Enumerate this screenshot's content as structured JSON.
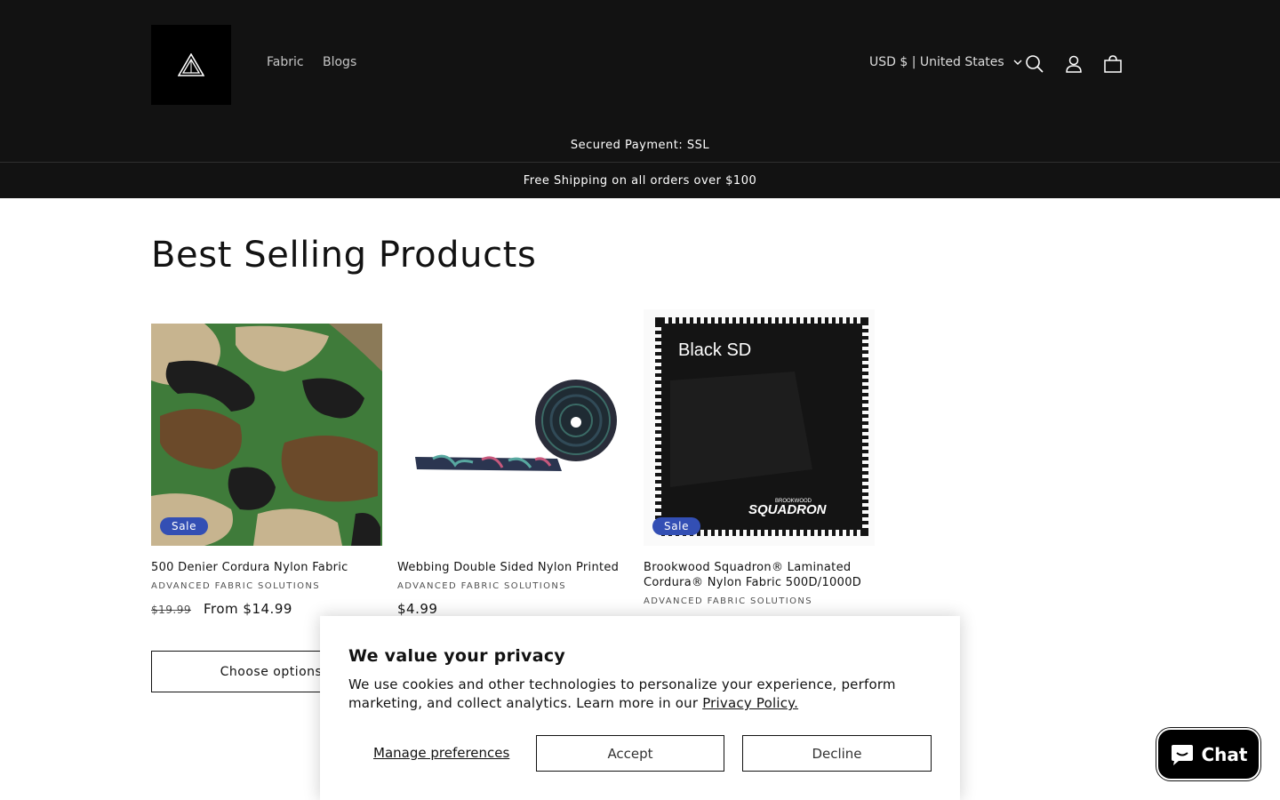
{
  "header": {
    "nav": [
      {
        "label": "Fabric"
      },
      {
        "label": "Blogs"
      }
    ],
    "currency_label": "USD $ | United States",
    "icons": {
      "search": "search-icon",
      "account": "account-icon",
      "cart": "cart-icon"
    }
  },
  "announcements": [
    {
      "text": "Secured Payment: SSL"
    },
    {
      "text": "Free Shipping on all orders over $100"
    }
  ],
  "section": {
    "title": "Best Selling Products"
  },
  "products": [
    {
      "title": "500 Denier Cordura Nylon Fabric",
      "vendor": "ADVANCED FABRIC SOLUTIONS",
      "old_price": "$19.99",
      "price": "From $14.99",
      "badge": "Sale",
      "button": "Choose options"
    },
    {
      "title": "Webbing Double Sided Nylon Printed",
      "vendor": "ADVANCED FABRIC SOLUTIONS",
      "price": "$4.99"
    },
    {
      "title": "Brookwood Squadron® Laminated Cordura® Nylon Fabric 500D/1000D",
      "vendor": "ADVANCED FABRIC SOLUTIONS",
      "badge": "Sale",
      "image_text": "Black SD",
      "image_brand_top": "BROOKWOOD",
      "image_brand": "SQUADRON"
    }
  ],
  "cookie_banner": {
    "title": "We value your privacy",
    "text": "We use cookies and other technologies to personalize your experience, perform marketing, and collect analytics. Learn more in our ",
    "link": "Privacy Policy.",
    "manage": "Manage preferences",
    "accept": "Accept",
    "decline": "Decline"
  },
  "chat": {
    "label": "Chat"
  },
  "colors": {
    "header_bg": "#121212",
    "sale_badge": "#334fb4",
    "chat_bg": "#000000"
  }
}
